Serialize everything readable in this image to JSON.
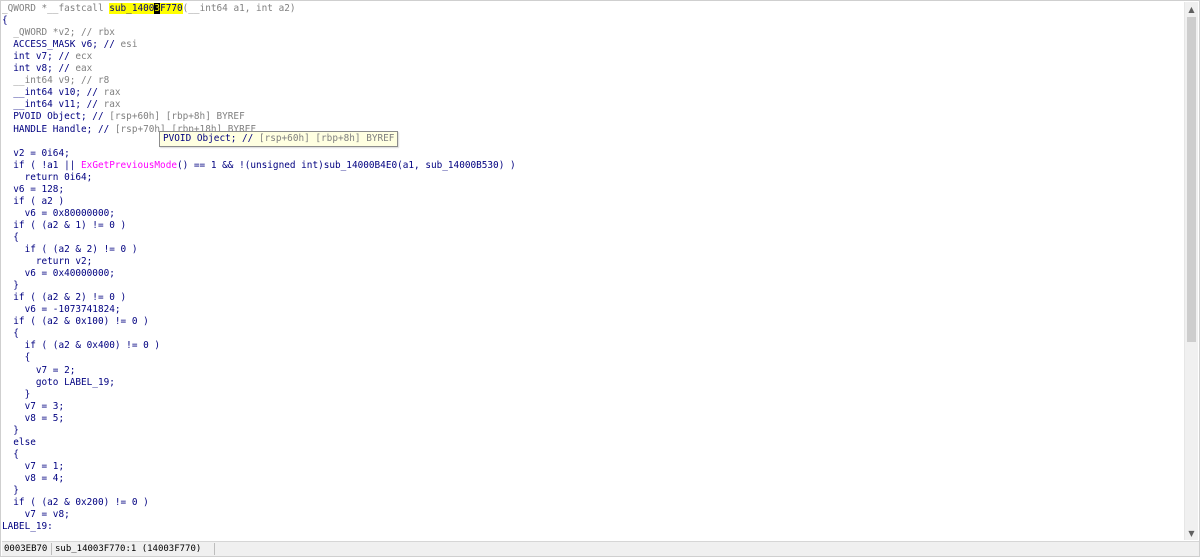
{
  "code": {
    "lines": [
      [
        [
          "_QWORD *__fastcall ",
          "tok-grey"
        ],
        [
          "sub_1400",
          "hl"
        ],
        [
          "3",
          "cursor"
        ],
        [
          "F770",
          "hl"
        ],
        [
          "(__int64 a1, int a2)",
          "tok-grey"
        ]
      ],
      [
        [
          "{",
          "tok-plain"
        ]
      ],
      [
        [
          "  _QWORD *v2; // ",
          "tok-grey"
        ],
        [
          "rbx",
          "tok-comment"
        ]
      ],
      [
        [
          "  ACCESS_MASK v6; // ",
          "tok-plain"
        ],
        [
          "esi",
          "tok-comment"
        ]
      ],
      [
        [
          "  int v7; // ",
          "tok-plain"
        ],
        [
          "ecx",
          "tok-comment"
        ]
      ],
      [
        [
          "  int v8; // ",
          "tok-plain"
        ],
        [
          "eax",
          "tok-comment"
        ]
      ],
      [
        [
          "  __int64 v9; // ",
          "tok-grey"
        ],
        [
          "r8",
          "tok-comment"
        ]
      ],
      [
        [
          "  __int64 v10; // ",
          "tok-plain"
        ],
        [
          "rax",
          "tok-comment"
        ]
      ],
      [
        [
          "  __int64 v11; // ",
          "tok-plain"
        ],
        [
          "rax",
          "tok-comment"
        ]
      ],
      [
        [
          "  PVOID Object; // ",
          "tok-plain"
        ],
        [
          "[rsp+60h] [rbp+8h] BYREF",
          "tok-comment"
        ]
      ],
      [
        [
          "  HANDLE Handle; // ",
          "tok-plain"
        ],
        [
          "[rsp+70h] [rbp+18h] BYREF",
          "tok-comment"
        ]
      ],
      [
        [
          "",
          "tok-plain"
        ]
      ],
      [
        [
          "  v2 = 0i64;",
          "tok-plain"
        ]
      ],
      [
        [
          "  if ( !a1 || ",
          "tok-plain"
        ],
        [
          "ExGetPreviousMode",
          "tok-pink"
        ],
        [
          "() == 1 && !(unsigned int)sub_14000B4E0(a1, sub_14000B530) )",
          "tok-plain"
        ]
      ],
      [
        [
          "    return 0i64;",
          "tok-plain"
        ]
      ],
      [
        [
          "  v6 = 128;",
          "tok-plain"
        ]
      ],
      [
        [
          "  if ( a2 )",
          "tok-plain"
        ]
      ],
      [
        [
          "    v6 = 0x80000000;",
          "tok-plain"
        ]
      ],
      [
        [
          "  if ( (a2 & 1) != 0 )",
          "tok-plain"
        ]
      ],
      [
        [
          "  {",
          "tok-plain"
        ]
      ],
      [
        [
          "    if ( (a2 & 2) != 0 )",
          "tok-plain"
        ]
      ],
      [
        [
          "      return v2;",
          "tok-plain"
        ]
      ],
      [
        [
          "    v6 = 0x40000000;",
          "tok-plain"
        ]
      ],
      [
        [
          "  }",
          "tok-plain"
        ]
      ],
      [
        [
          "  if ( (a2 & 2) != 0 )",
          "tok-plain"
        ]
      ],
      [
        [
          "    v6 = -1073741824;",
          "tok-plain"
        ]
      ],
      [
        [
          "  if ( (a2 & 0x100) != 0 )",
          "tok-plain"
        ]
      ],
      [
        [
          "  {",
          "tok-plain"
        ]
      ],
      [
        [
          "    if ( (a2 & 0x400) != 0 )",
          "tok-plain"
        ]
      ],
      [
        [
          "    {",
          "tok-plain"
        ]
      ],
      [
        [
          "      v7 = 2;",
          "tok-plain"
        ]
      ],
      [
        [
          "      goto LABEL_19;",
          "tok-plain"
        ]
      ],
      [
        [
          "    }",
          "tok-plain"
        ]
      ],
      [
        [
          "    v7 = 3;",
          "tok-plain"
        ]
      ],
      [
        [
          "    v8 = 5;",
          "tok-plain"
        ]
      ],
      [
        [
          "  }",
          "tok-plain"
        ]
      ],
      [
        [
          "  else",
          "tok-plain"
        ]
      ],
      [
        [
          "  {",
          "tok-plain"
        ]
      ],
      [
        [
          "    v7 = 1;",
          "tok-plain"
        ]
      ],
      [
        [
          "    v8 = 4;",
          "tok-plain"
        ]
      ],
      [
        [
          "  }",
          "tok-plain"
        ]
      ],
      [
        [
          "  if ( (a2 & 0x200) != 0 )",
          "tok-plain"
        ]
      ],
      [
        [
          "    v7 = v8;",
          "tok-plain"
        ]
      ],
      [
        [
          "LABEL_19:",
          "tok-plain"
        ]
      ]
    ]
  },
  "tooltip": {
    "prefix": "PVOID Object; // ",
    "comment": "[rsp+60h] [rbp+8h] BYREF"
  },
  "status": {
    "offset": "0003EB70",
    "location": "sub_14003F770:1 (14003F770)"
  },
  "scrollbar": {
    "up_icon": "▲",
    "down_icon": "▼",
    "position": 0
  },
  "colors": {
    "identifier": "#000080",
    "comment": "#808080",
    "api_call": "#ff00ff",
    "highlight": "#ffff00",
    "tooltip_bg": "#ffffe1"
  }
}
